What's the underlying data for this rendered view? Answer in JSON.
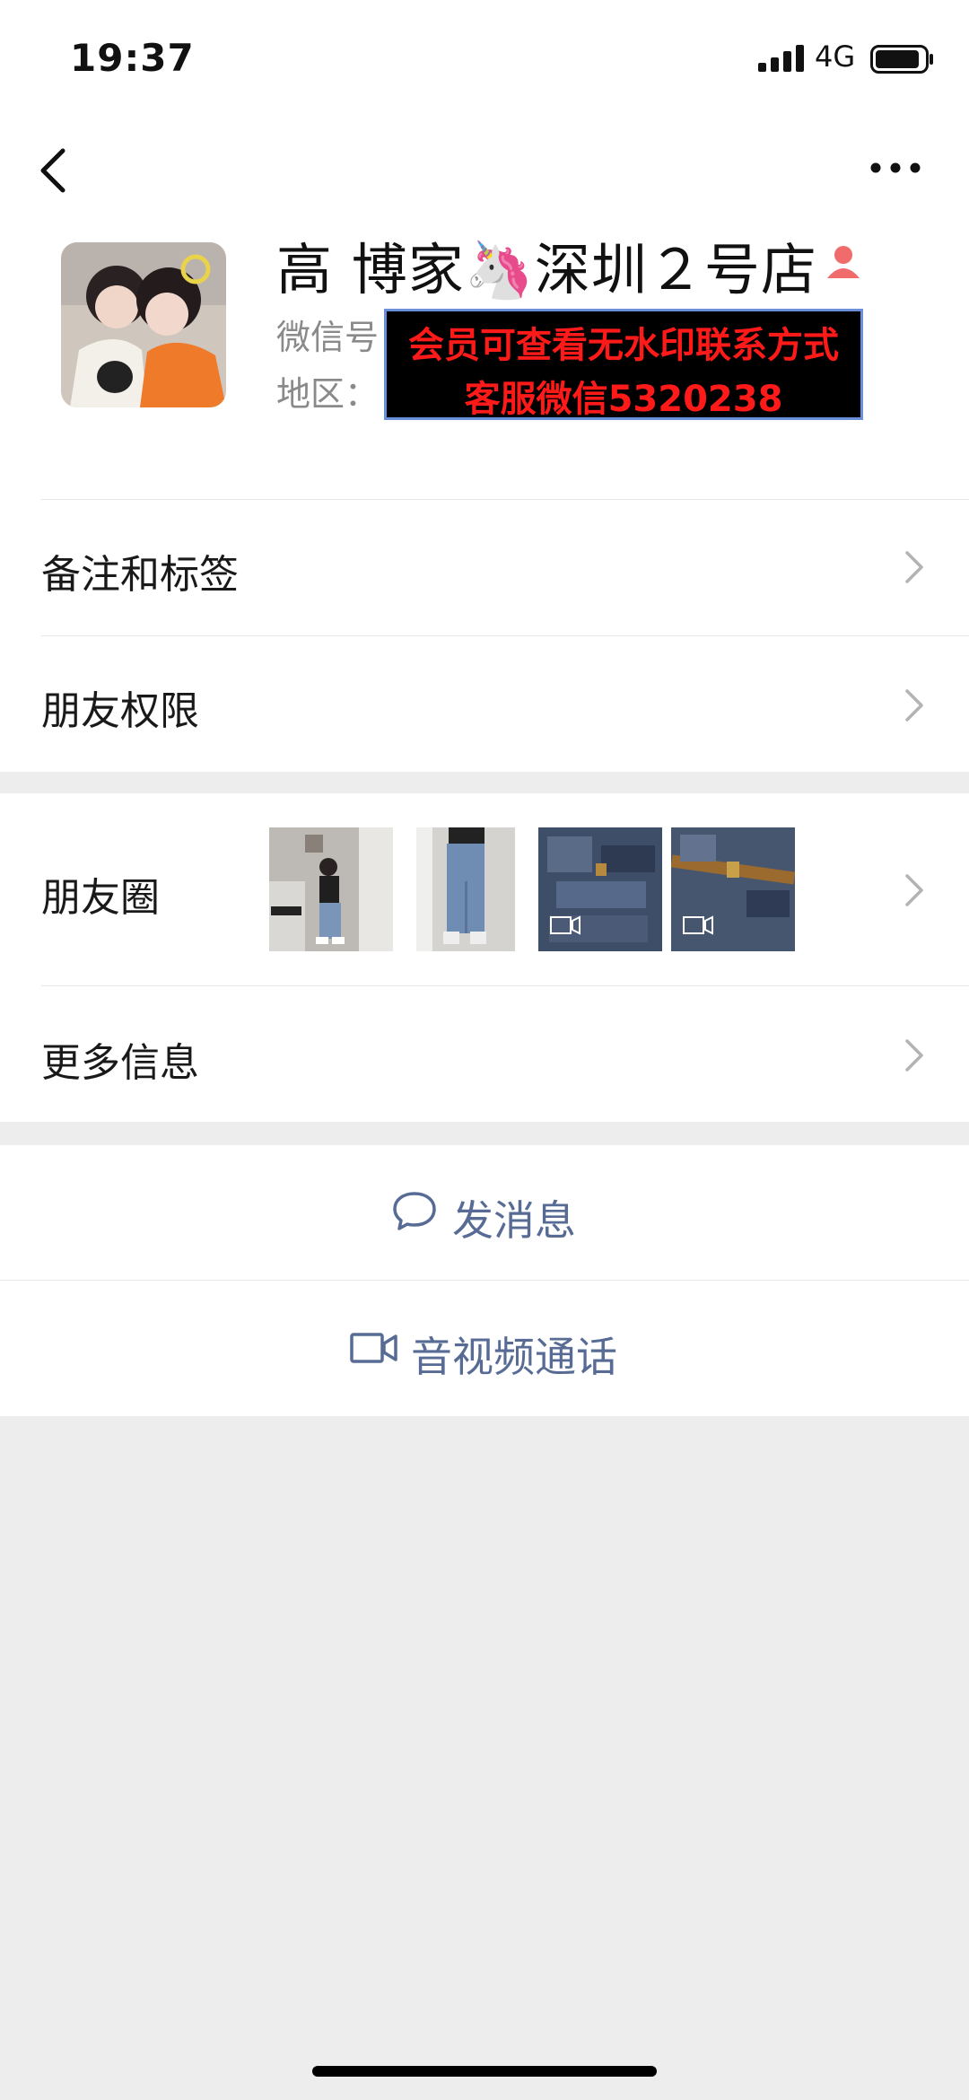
{
  "status_bar": {
    "time": "19:37",
    "network": "4G"
  },
  "profile": {
    "name": "高 博家🦄深圳２号店",
    "wechat_id_label": "微信号",
    "region_label": "地区：",
    "watermark_line1": "会员可查看无水印联系方式",
    "watermark_line2": "客服微信5320238"
  },
  "menu": {
    "remarks_tags": "备注和标签",
    "friend_permissions": "朋友权限",
    "moments": "朋友圈",
    "more_info": "更多信息"
  },
  "actions": {
    "send_message": "发消息",
    "video_call": "音视频通话"
  },
  "colors": {
    "link": "#576b95",
    "background": "#ededed",
    "badge": "#f06b6b"
  }
}
